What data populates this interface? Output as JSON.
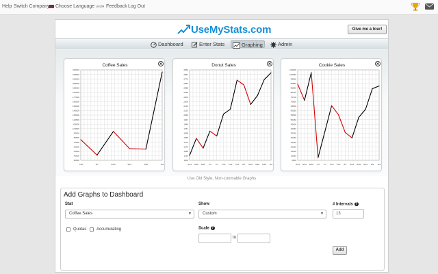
{
  "topnav": {
    "help": "Help",
    "switch_company": "Switch Company",
    "choose_language": "Choose Language",
    "language_native": "अंग्रेज़ी",
    "feedback": "Feedback",
    "logout": "Log Out"
  },
  "app": {
    "logo_text": "UseMyStats.com",
    "tour_button": "Give me a tour!"
  },
  "nav": [
    {
      "label": "Dashboard",
      "icon": "dashboard-icon"
    },
    {
      "label": "Enter Stats",
      "icon": "pencil-icon"
    },
    {
      "label": "Graphing",
      "icon": "graph-icon",
      "active": true
    },
    {
      "label": "Admin",
      "icon": "gear-icon"
    }
  ],
  "chart_data": [
    {
      "type": "line",
      "title": "Coffee Sales",
      "x": [
        "7/18",
        "8/7",
        "8/24",
        "9/12",
        "9/30",
        "9/4"
      ],
      "series": [
        {
          "values": [
            78000,
            42000,
            97000,
            57000,
            56000,
            235000
          ]
        }
      ],
      "below_goal_color": "#d40000",
      "above_goal_color": "#000000",
      "ylim": [
        30000,
        240000
      ],
      "grid": true
    },
    {
      "type": "line",
      "title": "Donut Sales",
      "x": [
        "6/14",
        "6/28",
        "6/26",
        "7/1",
        "7/7",
        "7/12",
        "7/22",
        "7/31",
        "8/7",
        "8/24",
        "8/20",
        "8/16",
        "9/3"
      ],
      "series": [
        {
          "values": [
            1200,
            1550,
            1350,
            1700,
            1600,
            2050,
            2150,
            2750,
            2650,
            2250,
            2430,
            2760,
            2900
          ]
        }
      ],
      "below_goal_color": "#d40000",
      "above_goal_color": "#000000",
      "ylim": [
        1100,
        2960
      ],
      "grid": true
    },
    {
      "type": "line",
      "title": "Cookie Sales",
      "x": [
        "8/14",
        "8/24",
        "8/26",
        "7/3",
        "7/7",
        "7/12",
        "7/23",
        "8/7",
        "8/14",
        "8/20",
        "8/31",
        "9/6",
        "9/4"
      ],
      "series": [
        {
          "values": [
            90000,
            72000,
            103000,
            8000,
            37000,
            66000,
            56000,
            36000,
            30000,
            53000,
            62000,
            85000,
            88000
          ]
        }
      ],
      "below_goal_color": "#d40000",
      "above_goal_color": "#000000",
      "ylim": [
        5000,
        106000
      ],
      "grid": true
    }
  ],
  "old_style_link": "Use Old Style, Non-zoomable Graphs",
  "form": {
    "title": "Add Graphs to Dashboard",
    "stat_label": "Stat",
    "stat_value": "Coffee Sales",
    "show_label": "Show",
    "show_value": "Custom",
    "intervals_label": "# Intervals",
    "intervals_value": "13",
    "quotas_label": "Quotas",
    "accumulating_label": "Accumulating",
    "scale_label": "Scale",
    "scale_to": "to",
    "add_button": "Add"
  }
}
